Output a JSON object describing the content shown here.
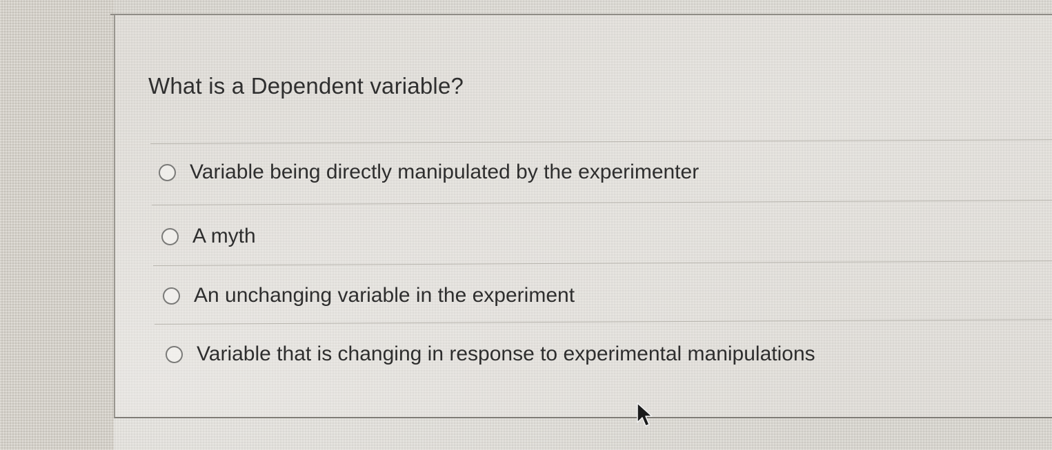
{
  "question": {
    "text": "What is a Dependent variable?"
  },
  "options": [
    {
      "label": "Variable being directly manipulated by the experimenter",
      "selected": false
    },
    {
      "label": "A myth",
      "selected": false
    },
    {
      "label": "An unchanging variable in the experiment",
      "selected": false
    },
    {
      "label": "Variable that is changing in response to experimental manipulations",
      "selected": false
    }
  ],
  "icons": {
    "cursor": "mouse-pointer-icon"
  }
}
